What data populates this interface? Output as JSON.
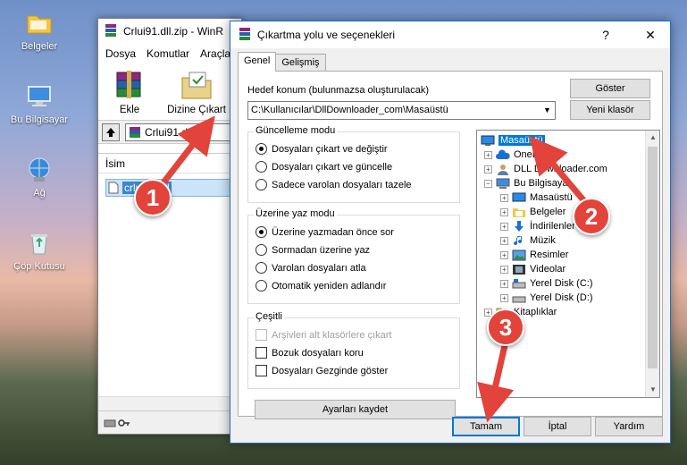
{
  "desktop": {
    "icons": [
      {
        "label": "Belgeler",
        "icon": "folder-icon"
      },
      {
        "label": "Bu Bilgisayar",
        "icon": "computer-icon"
      },
      {
        "label": "Ağ",
        "icon": "network-icon"
      },
      {
        "label": "Çöp Kutusu",
        "icon": "recycle-bin-icon"
      }
    ]
  },
  "winrar": {
    "title": "Crlui91.dll.zip - WinR",
    "menu": [
      "Dosya",
      "Komutlar",
      "Araçla"
    ],
    "toolbar": {
      "add_label": "Ekle",
      "extract_label": "Dizine Çıkart"
    },
    "address": "Crlui91.dll.za",
    "column_name": "İsim",
    "file_name": "crlui91.dll"
  },
  "dialog": {
    "title": "Çıkartma yolu ve seçenekleri",
    "help_glyph": "?",
    "close_glyph": "✕",
    "tabs": [
      "Genel",
      "Gelişmiş"
    ],
    "destination_label": "Hedef konum (bulunmazsa oluşturulacak)",
    "destination_value": "C:\\Kullanıcılar\\DllDownloader_com\\Masaüstü",
    "show_button": "Göster",
    "new_folder_button": "Yeni klasör",
    "update_mode": {
      "title": "Güncelleme modu",
      "options": [
        "Dosyaları çıkart ve değiştir",
        "Dosyaları çıkart ve güncelle",
        "Sadece varolan dosyaları tazele"
      ],
      "selected": 0
    },
    "overwrite_mode": {
      "title": "Üzerine yaz modu",
      "options": [
        "Üzerine yazmadan önce sor",
        "Sormadan üzerine yaz",
        "Varolan dosyaları atla",
        "Otomatik yeniden adlandır"
      ],
      "selected": 0
    },
    "misc": {
      "title": "Çeşitli",
      "options": [
        "Arşivleri alt klasörlere çıkart",
        "Bozuk dosyaları koru",
        "Dosyaları Gezginde göster"
      ],
      "disabled": [
        true,
        false,
        false
      ]
    },
    "save_settings_button": "Ayarları kaydet",
    "tree": [
      {
        "label": "Masaüstü",
        "level": 0,
        "expander": "",
        "icon": "desktop-icon",
        "selected": true
      },
      {
        "label": "OneDrive",
        "level": 1,
        "expander": "+",
        "icon": "cloud-icon"
      },
      {
        "label": "DLL Downloader.com",
        "level": 1,
        "expander": "+",
        "icon": "user-icon"
      },
      {
        "label": "Bu Bilgisayar",
        "level": 1,
        "expander": "−",
        "icon": "computer-icon"
      },
      {
        "label": "Masaüstü",
        "level": 2,
        "expander": "+",
        "icon": "desktop-icon"
      },
      {
        "label": "Belgeler",
        "level": 2,
        "expander": "+",
        "icon": "documents-icon"
      },
      {
        "label": "İndirilenler",
        "level": 2,
        "expander": "+",
        "icon": "download-icon"
      },
      {
        "label": "Müzik",
        "level": 2,
        "expander": "+",
        "icon": "music-icon"
      },
      {
        "label": "Resimler",
        "level": 2,
        "expander": "+",
        "icon": "pictures-icon"
      },
      {
        "label": "Videolar",
        "level": 2,
        "expander": "+",
        "icon": "videos-icon"
      },
      {
        "label": "Yerel Disk (C:)",
        "level": 2,
        "expander": "+",
        "icon": "drive-icon"
      },
      {
        "label": "Yerel Disk (D:)",
        "level": 2,
        "expander": "+",
        "icon": "drive-icon"
      },
      {
        "label": "Kitaplıklar",
        "level": 1,
        "expander": "+",
        "icon": "library-icon"
      }
    ],
    "ok_button": "Tamam",
    "cancel_button": "İptal",
    "help_button": "Yardım"
  },
  "annotations": {
    "markers": [
      "1",
      "2",
      "3"
    ],
    "color": "#e2433b"
  }
}
